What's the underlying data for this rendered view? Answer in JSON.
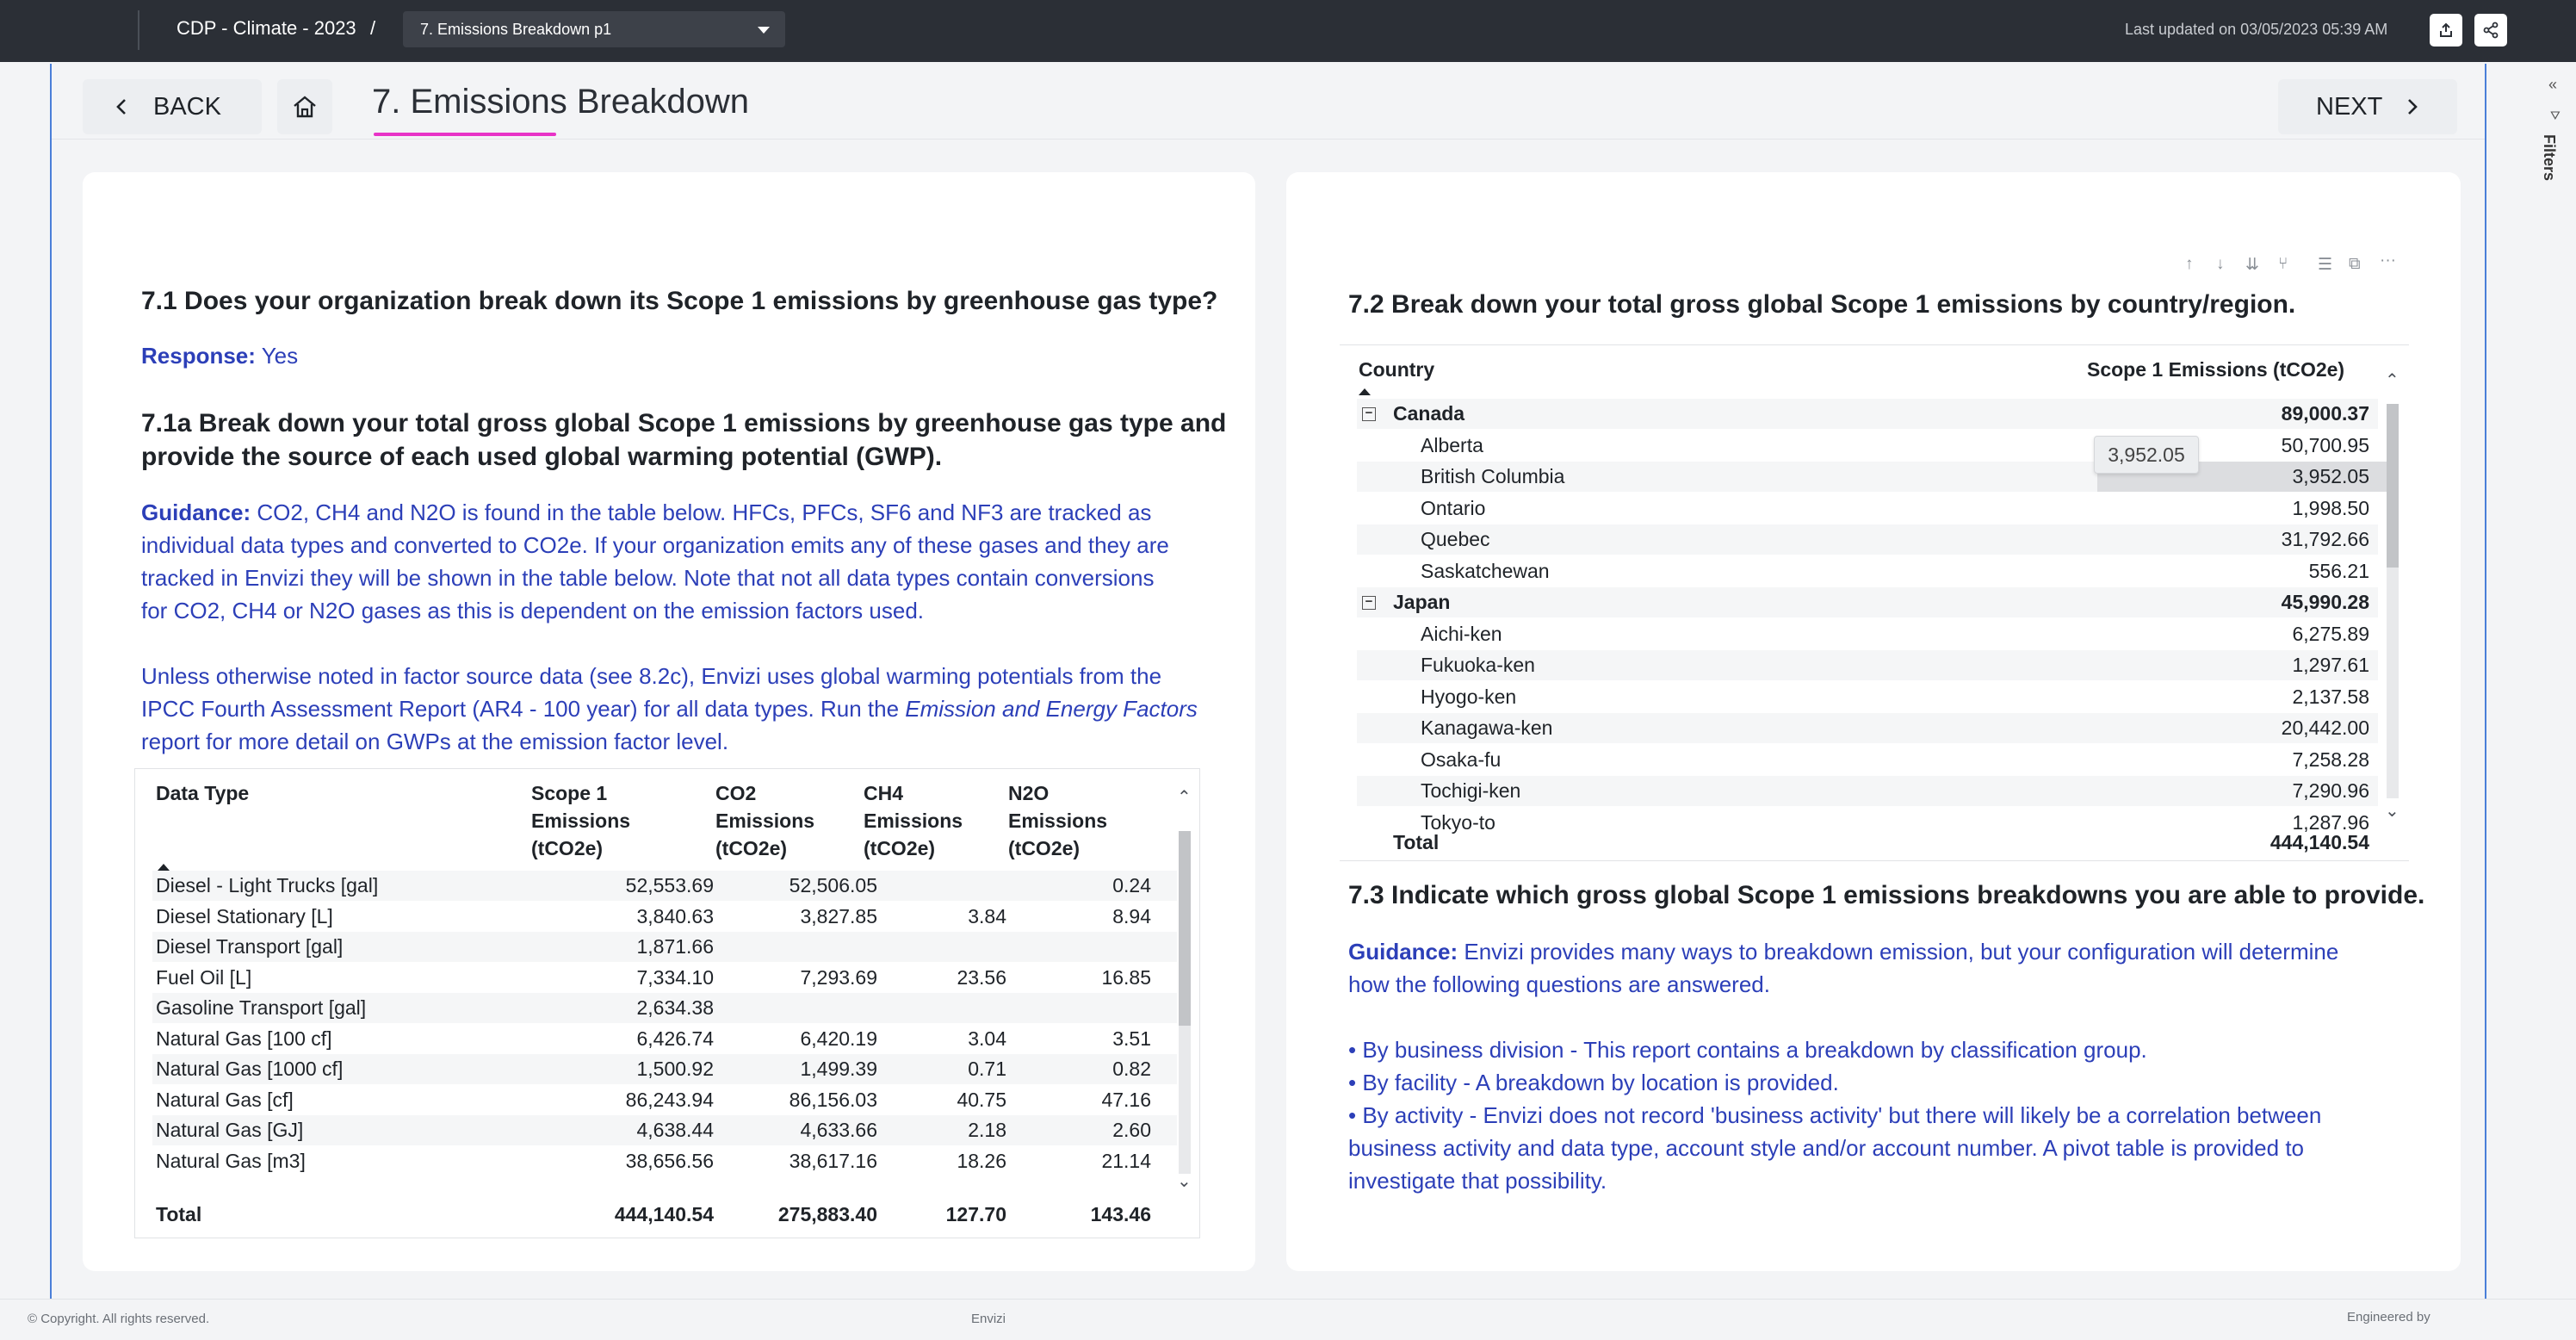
{
  "topbar": {
    "app_title": "CDP - Climate - 2023",
    "separator": "/",
    "page_select": "7. Emissions Breakdown p1",
    "last_updated": "Last updated on 03/05/2023 05:39 AM"
  },
  "nav": {
    "back_label": "BACK",
    "page_title": "7. Emissions Breakdown",
    "next_label": "NEXT"
  },
  "left": {
    "q71": "7.1 Does your organization break down its Scope 1 emissions by greenhouse gas type?",
    "response_label": "Response:",
    "response_value": "Yes",
    "q71a_line1": "7.1a Break down your total gross global Scope 1 emissions by greenhouse gas type and",
    "q71a_line2": "provide the source of each used global warming potential (GWP).",
    "guidance_label": "Guidance:",
    "guidance_l1": "CO2, CH4 and N2O is found in the table below. HFCs, PFCs, SF6 and NF3 are tracked as",
    "guidance_l2": "individual data types and converted to CO2e. If your organization emits any of these gases and they are",
    "guidance_l3": "tracked in Envizi they will be shown in the table below. Note that not all data types contain conversions",
    "guidance_l4": "for CO2, CH4 or N2O gases as this is dependent on the emission factors used.",
    "para2_l1": "Unless otherwise noted in factor source data (see 8.2c), Envizi uses global warming potentials from the",
    "para2_l2a": "IPCC Fourth Assessment Report (AR4 - 100 year) for all data types. Run the ",
    "para2_l2_italic": "Emission and Energy Factors",
    "para2_l3": "report for more detail on GWPs at the emission factor level.",
    "table": {
      "headers": {
        "data_type": "Data Type",
        "scope1": [
          "Scope 1",
          "Emissions",
          "(tCO2e)"
        ],
        "co2": [
          "CO2",
          "Emissions",
          "(tCO2e)"
        ],
        "ch4": [
          "CH4",
          "Emissions",
          "(tCO2e)"
        ],
        "n2o": [
          "N2O",
          "Emissions",
          "(tCO2e)"
        ]
      },
      "rows": [
        {
          "type": "Diesel - Light Trucks [gal]",
          "scope1": "52,553.69",
          "co2": "52,506.05",
          "ch4": "",
          "n2o": "0.24"
        },
        {
          "type": "Diesel Stationary [L]",
          "scope1": "3,840.63",
          "co2": "3,827.85",
          "ch4": "3.84",
          "n2o": "8.94"
        },
        {
          "type": "Diesel Transport [gal]",
          "scope1": "1,871.66",
          "co2": "",
          "ch4": "",
          "n2o": ""
        },
        {
          "type": "Fuel Oil [L]",
          "scope1": "7,334.10",
          "co2": "7,293.69",
          "ch4": "23.56",
          "n2o": "16.85"
        },
        {
          "type": "Gasoline Transport [gal]",
          "scope1": "2,634.38",
          "co2": "",
          "ch4": "",
          "n2o": ""
        },
        {
          "type": "Natural Gas [100 cf]",
          "scope1": "6,426.74",
          "co2": "6,420.19",
          "ch4": "3.04",
          "n2o": "3.51"
        },
        {
          "type": "Natural Gas [1000 cf]",
          "scope1": "1,500.92",
          "co2": "1,499.39",
          "ch4": "0.71",
          "n2o": "0.82"
        },
        {
          "type": "Natural Gas [cf]",
          "scope1": "86,243.94",
          "co2": "86,156.03",
          "ch4": "40.75",
          "n2o": "47.16"
        },
        {
          "type": "Natural Gas [GJ]",
          "scope1": "4,638.44",
          "co2": "4,633.66",
          "ch4": "2.18",
          "n2o": "2.60"
        },
        {
          "type": "Natural Gas [m3]",
          "scope1": "38,656.56",
          "co2": "38,617.16",
          "ch4": "18.26",
          "n2o": "21.14"
        }
      ],
      "total": {
        "label": "Total",
        "scope1": "444,140.54",
        "co2": "275,883.40",
        "ch4": "127.70",
        "n2o": "143.46"
      }
    }
  },
  "right": {
    "q72": "7.2 Break down your total gross global Scope 1 emissions by country/region.",
    "table": {
      "col_country": "Country",
      "col_emissions": "Scope 1 Emissions (tCO2e)",
      "groups": [
        {
          "name": "Canada",
          "total": "89,000.37",
          "rows": [
            {
              "name": "Alberta",
              "value": "50,700.95"
            },
            {
              "name": "British Columbia",
              "value": "3,952.05"
            },
            {
              "name": "Ontario",
              "value": "1,998.50"
            },
            {
              "name": "Quebec",
              "value": "31,792.66"
            },
            {
              "name": "Saskatchewan",
              "value": "556.21"
            }
          ]
        },
        {
          "name": "Japan",
          "total": "45,990.28",
          "rows": [
            {
              "name": "Aichi-ken",
              "value": "6,275.89"
            },
            {
              "name": "Fukuoka-ken",
              "value": "1,297.61"
            },
            {
              "name": "Hyogo-ken",
              "value": "2,137.58"
            },
            {
              "name": "Kanagawa-ken",
              "value": "20,442.00"
            },
            {
              "name": "Osaka-fu",
              "value": "7,258.28"
            },
            {
              "name": "Tochigi-ken",
              "value": "7,290.96"
            },
            {
              "name": "Tokyo-to",
              "value": "1,287.96"
            }
          ]
        }
      ],
      "total_label": "Total",
      "total_value": "444,140.54",
      "tooltip": "3,952.05"
    },
    "q73": "7.3 Indicate which gross global Scope 1 emissions breakdowns you are able to provide.",
    "guidance_label": "Guidance:",
    "guidance_l1": "Envizi provides many ways to breakdown emission, but your configuration will determine",
    "guidance_l2": "how the following questions are answered.",
    "bullet1": "• By business division - This report contains a breakdown by classification group.",
    "bullet2": "• By facility - A breakdown by location is provided.",
    "bullet3_l1": "• By activity - Envizi does not record 'business activity' but there will likely be a correlation between",
    "bullet3_l2": "business activity and data type, account style and/or account number. A pivot table is provided to",
    "bullet3_l3": "investigate that possibility."
  },
  "sidebar": {
    "filters_label": "Filters",
    "collapse_glyph": "«",
    "filter_glyph": "⛛"
  },
  "footer": {
    "copyright": "© Copyright. All rights reserved.",
    "center": "Envizi",
    "engineered": "Engineered by"
  },
  "colors": {
    "accent_pink": "#e833c7",
    "text_blue": "#2c3fb8",
    "topbar": "#2b2f36",
    "frame_border": "#4a7fd8"
  }
}
